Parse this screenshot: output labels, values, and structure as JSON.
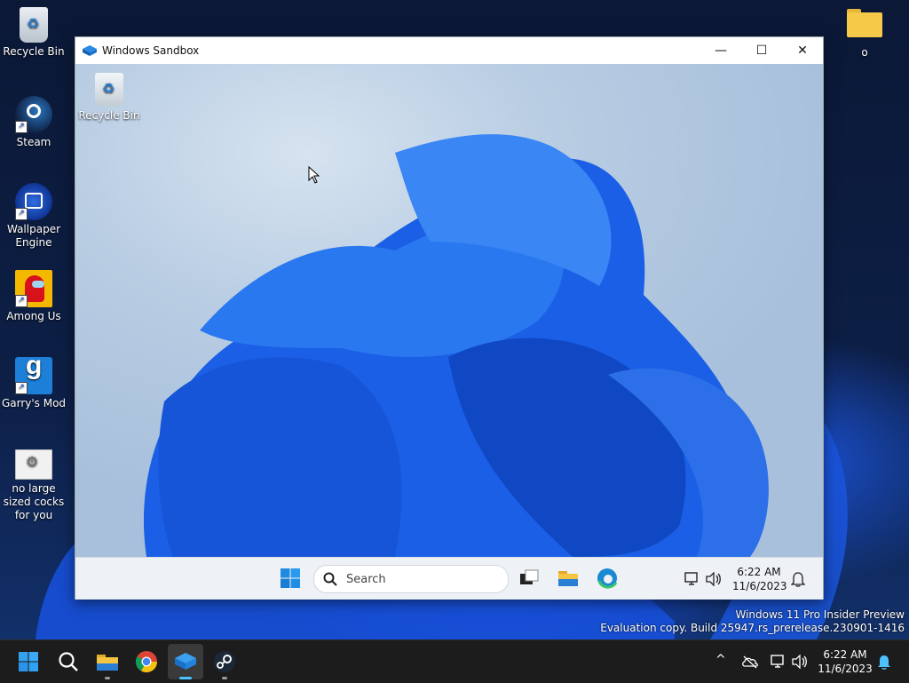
{
  "desktop": {
    "icons": [
      {
        "label": "Recycle Bin"
      },
      {
        "label": "Steam"
      },
      {
        "label": "Wallpaper Engine"
      },
      {
        "label": "Among Us"
      },
      {
        "label": "Garry's Mod"
      },
      {
        "label": "no large sized cocks for you"
      }
    ],
    "folder_label": "o",
    "watermark": {
      "line1": "Windows 11 Pro Insider Preview",
      "line2": "Evaluation copy. Build 25947.rs_prerelease.230901-1416"
    }
  },
  "sandbox": {
    "title": "Windows Sandbox",
    "controls": {
      "minimize": "—",
      "maximize": "☐",
      "close": "✕"
    },
    "guest_desktop": {
      "recycle_label": "Recycle Bin"
    },
    "guest_taskbar": {
      "search_placeholder": "Search",
      "time": "6:22 AM",
      "date": "11/6/2023"
    }
  },
  "taskbar": {
    "time": "6:22 AM",
    "date": "11/6/2023",
    "chevron": "^"
  },
  "colors": {
    "accent": "#1f6fd6",
    "taskbar": "#1c1c1c"
  }
}
